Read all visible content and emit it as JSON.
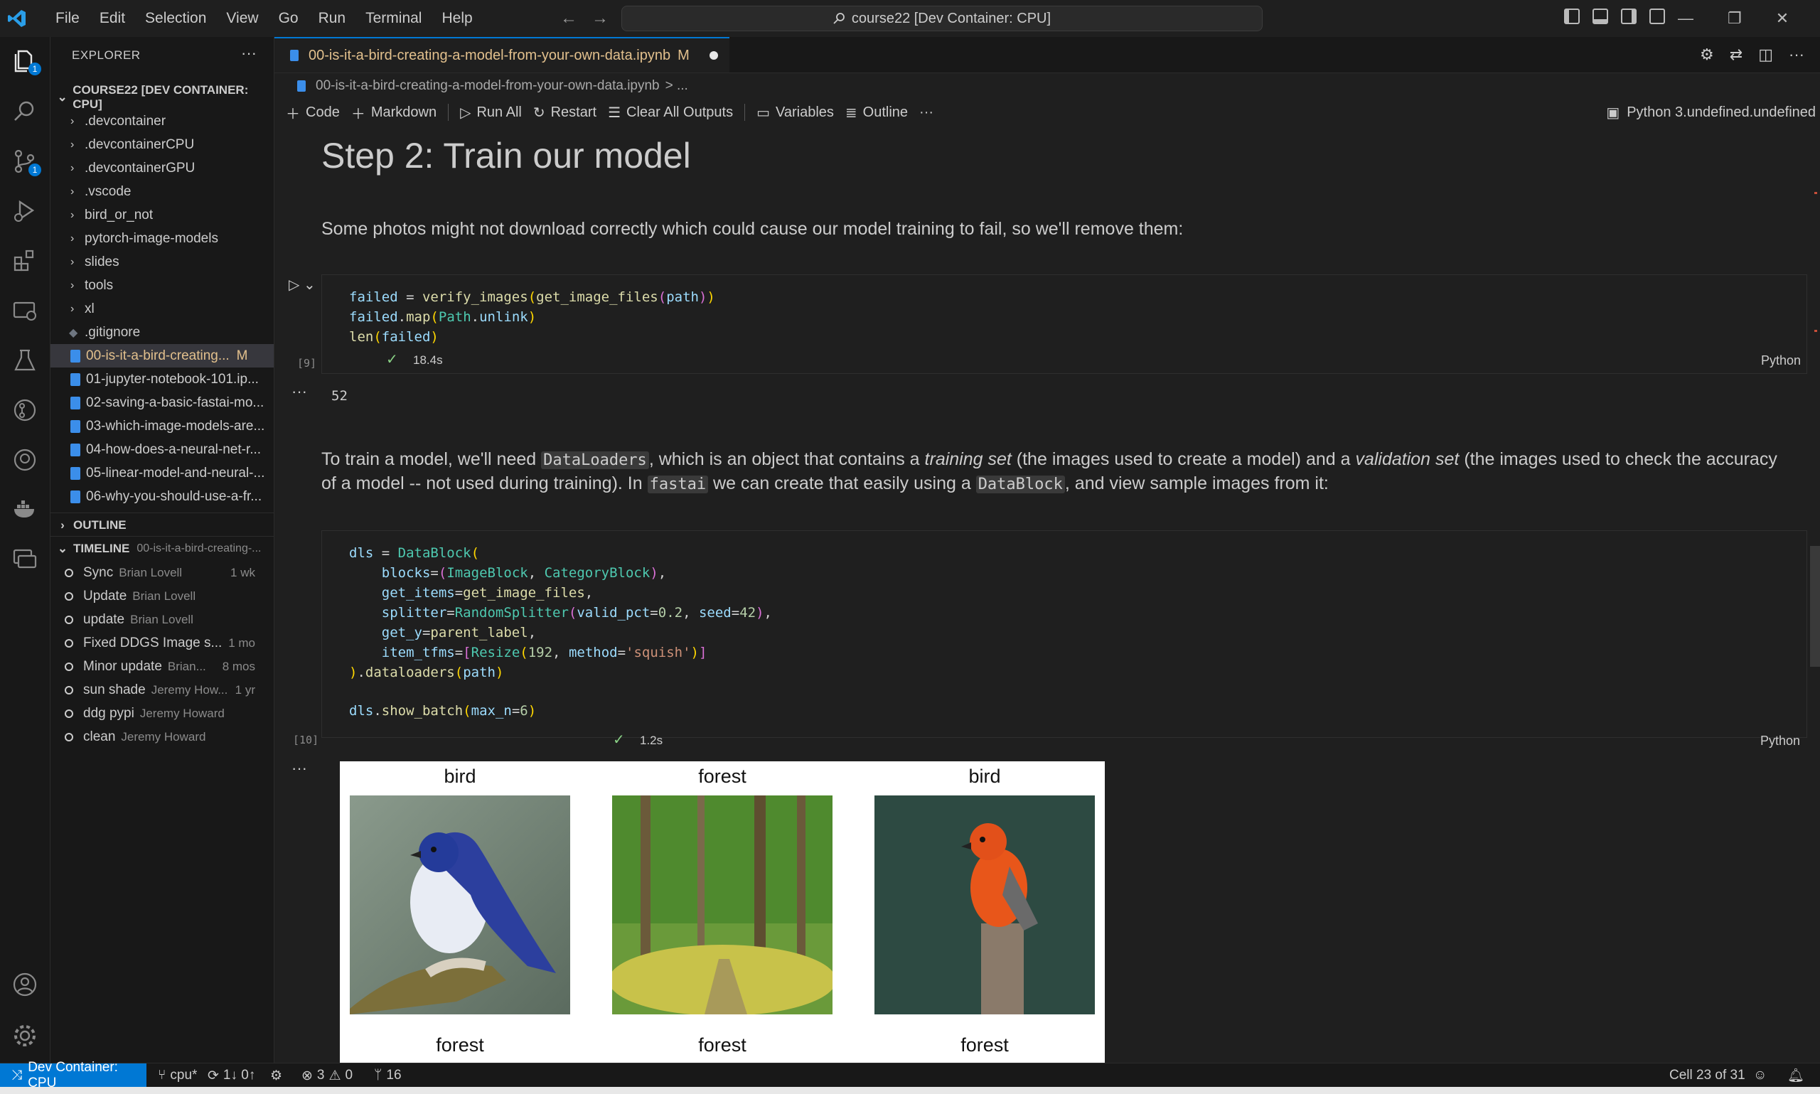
{
  "titlebar": {
    "menu": [
      "File",
      "Edit",
      "Selection",
      "View",
      "Go",
      "Run",
      "Terminal",
      "Help"
    ],
    "command_center": "course22 [Dev Container: CPU]"
  },
  "activity": {
    "explorer_badge": "1",
    "scm_badge": "1"
  },
  "sidebar": {
    "title": "EXPLORER",
    "root": "COURSE22 [DEV CONTAINER: CPU]",
    "folders": [
      ".devcontainer",
      ".devcontainerCPU",
      ".devcontainerGPU",
      ".vscode",
      "bird_or_not",
      "pytorch-image-models",
      "slides",
      "tools",
      "xl"
    ],
    "gitignore": ".gitignore",
    "files": [
      {
        "name": "00-is-it-a-bird-creating...",
        "status": "M"
      },
      {
        "name": "01-jupyter-notebook-101.ip..."
      },
      {
        "name": "02-saving-a-basic-fastai-mo..."
      },
      {
        "name": "03-which-image-models-are..."
      },
      {
        "name": "04-how-does-a-neural-net-r..."
      },
      {
        "name": "05-linear-model-and-neural-..."
      },
      {
        "name": "06-why-you-should-use-a-fr..."
      }
    ],
    "outline": "OUTLINE",
    "timeline": "TIMELINE",
    "timeline_file": "00-is-it-a-bird-creating-...",
    "timeline_items": [
      {
        "title": "Sync",
        "author": "Brian Lovell",
        "when": "1 wk"
      },
      {
        "title": "Update",
        "author": "Brian Lovell",
        "when": ""
      },
      {
        "title": "update",
        "author": "Brian Lovell",
        "when": ""
      },
      {
        "title": "Fixed DDGS Image s...",
        "author": "",
        "when": "1 mo"
      },
      {
        "title": "Minor update",
        "author": "Brian...",
        "when": "8 mos"
      },
      {
        "title": "sun shade",
        "author": "Jeremy How...",
        "when": "1 yr"
      },
      {
        "title": "ddg pypi",
        "author": "Jeremy Howard",
        "when": ""
      },
      {
        "title": "clean",
        "author": "Jeremy Howard",
        "when": ""
      }
    ]
  },
  "editor": {
    "tab_title": "00-is-it-a-bird-creating-a-model-from-your-own-data.ipynb",
    "tab_status": "M",
    "breadcrumb": "00-is-it-a-bird-creating-a-model-from-your-own-data.ipynb",
    "breadcrumb_more": "> ...",
    "toolbar": {
      "code": "Code",
      "markdown": "Markdown",
      "run_all": "Run All",
      "restart": "Restart",
      "clear": "Clear All Outputs",
      "variables": "Variables",
      "outline": "Outline",
      "more": "···",
      "kernel": "Python 3.undefined.undefined"
    }
  },
  "notebook": {
    "heading": "Step 2: Train our model",
    "para1": "Some photos might not download correctly which could cause our model training to fail, so we'll remove them:",
    "cell1": {
      "lines": [
        "failed = verify_images(get_image_files(path))",
        "failed.map(Path.unlink)",
        "len(failed)"
      ],
      "exec": "[9]",
      "time": "18.4s",
      "lang": "Python",
      "output": "52"
    },
    "para2": {
      "t1": "To train a model, we'll need ",
      "c1": "DataLoaders",
      "t2": ", which is an object that contains a ",
      "e1": "training set",
      "t3": " (the images used to create a model) and a ",
      "e2": "validation set",
      "t4": " (the images used to check the accuracy of a model -- not used during training). In ",
      "c2": "fastai",
      "t5": " we can create that easily using a ",
      "c3": "DataBlock",
      "t6": ", and view sample images from it:"
    },
    "cell2": {
      "exec": "[10]",
      "time": "1.2s",
      "lang": "Python"
    },
    "batch_labels": [
      "bird",
      "forest",
      "bird",
      "forest",
      "forest",
      "forest"
    ]
  },
  "statusbar": {
    "remote": "Dev Container: CPU",
    "branch": "cpu*",
    "sync": "1↓ 0↑",
    "errors": "3",
    "warnings": "0",
    "ports": "16",
    "cell": "Cell 23 of 31"
  },
  "colors": {
    "accent": "#0078d4",
    "modified": "#e2c08d",
    "success": "#89d185"
  }
}
